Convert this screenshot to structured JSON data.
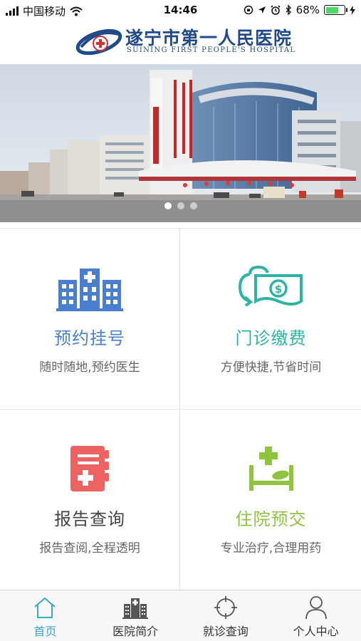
{
  "status_bar": {
    "carrier": "中国移动",
    "time": "14:46",
    "battery": "68%",
    "battery_level": 0.68
  },
  "header": {
    "title": "遂宁市第一人民医院",
    "subtitle": "SUINING FIRST PEOPLE'S HOSPITAL",
    "logo_icon": "hospital-logo-icon"
  },
  "banner": {
    "slide_count": 3,
    "active_slide": 1,
    "image": "hospital-building-photo"
  },
  "services": [
    {
      "title": "预约挂号",
      "desc": "随时随地,预约医生",
      "icon": "hospital-building-icon",
      "color": "#4a7fd0"
    },
    {
      "title": "门诊缴费",
      "desc": "方便快捷,节省时间",
      "icon": "money-payment-icon",
      "color": "#2cb5a4"
    },
    {
      "title": "报告查询",
      "desc": "报告查阅,全程透明",
      "icon": "medical-report-icon",
      "color": "#ef6262"
    },
    {
      "title": "住院预交",
      "desc": "专业治疗,合理用药",
      "icon": "hospital-bed-icon",
      "color": "#8fc43e"
    }
  ],
  "tab_bar": {
    "active_color": "#3ba7c9",
    "tabs": [
      {
        "label": "首页",
        "icon": "home-icon",
        "active": true
      },
      {
        "label": "医院简介",
        "icon": "hospital-building-icon",
        "active": false
      },
      {
        "label": "就诊查询",
        "icon": "crosshair-icon",
        "active": false
      },
      {
        "label": "个人中心",
        "icon": "user-icon",
        "active": false
      }
    ]
  }
}
